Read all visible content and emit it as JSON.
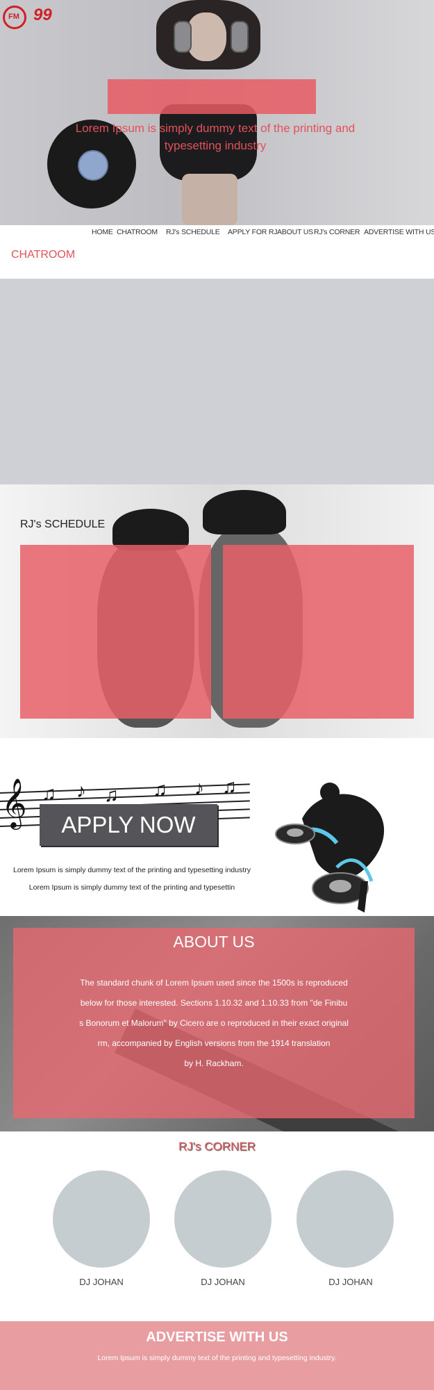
{
  "logo": {
    "fm_text": "FM",
    "number": "99"
  },
  "hero": {
    "tagline": "Lorem Ipsum is simply dummy text of the printing and typesetting industry"
  },
  "nav": {
    "items": [
      {
        "label": "HOME"
      },
      {
        "label": "CHATROOM"
      },
      {
        "label": "RJ's SCHEDULE"
      },
      {
        "label": "APPLY FOR RJ"
      },
      {
        "label": "ABOUT US"
      },
      {
        "label": "RJ's CORNER"
      },
      {
        "label": "ADVERTISE WITH US"
      }
    ]
  },
  "chatroom": {
    "title": "CHATROOM"
  },
  "schedule": {
    "title": "RJ's SCHEDULE"
  },
  "apply": {
    "button_label": "APPLY NOW",
    "line1": "Lorem Ipsum is simply dummy text of the printing and typesetting industry",
    "line2": "Lorem Ipsum is simply dummy text of the printing and typesettin"
  },
  "about": {
    "title": "ABOUT US",
    "lines": [
      "The standard chunk of Lorem Ipsum used since the 1500s is reproduced",
      "below for those interested. Sections 1.10.32  and 1.10.33 from \"de Finibu",
      "s Bonorum et Malorum\" by Cicero are o reproduced in their exact original",
      "rm, accompanied by English versions from the 1914 translation",
      "by H. Rackham."
    ]
  },
  "corner": {
    "title": "RJ's CORNER",
    "djs": [
      {
        "name": "DJ JOHAN"
      },
      {
        "name": "DJ JOHAN"
      },
      {
        "name": "DJ JOHAN"
      }
    ]
  },
  "advertise": {
    "title": "ADVERTISE WITH US",
    "text": "Lorem Ipsum is simply dummy text of the printing and typesetting industry."
  },
  "colors": {
    "accent": "#e2525a",
    "panel_pink": "#e86870",
    "footer_pink": "#e89da1",
    "chat_gray": "#cfcfd6"
  }
}
